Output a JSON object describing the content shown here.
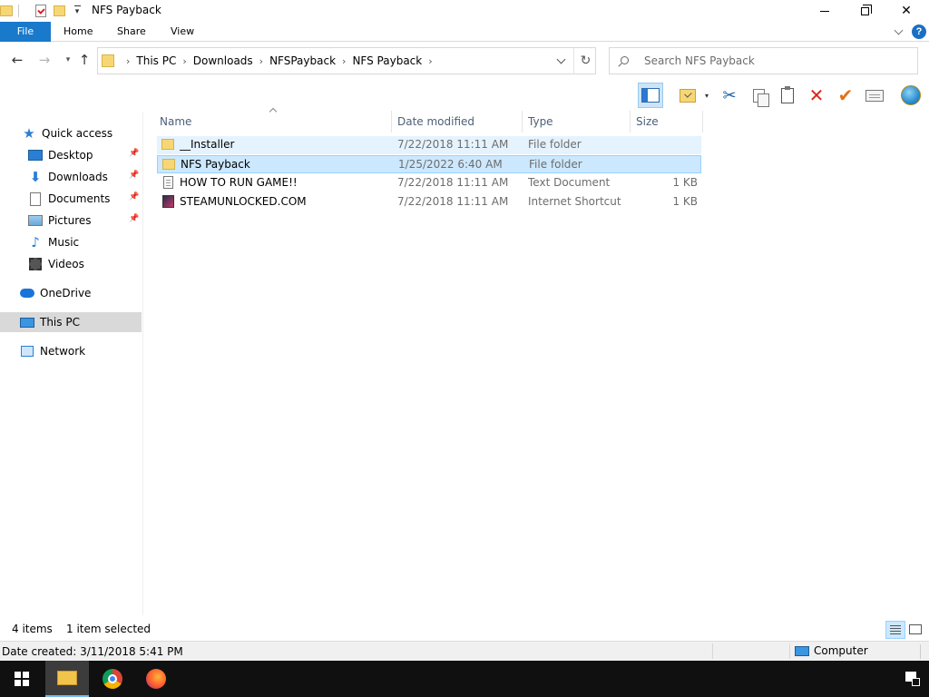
{
  "window": {
    "title": "NFS Payback",
    "controls": {
      "minimize": "minimize",
      "maximize": "restore",
      "close": "✕"
    }
  },
  "ribbon": {
    "tabs": [
      "File",
      "Home",
      "Share",
      "View"
    ],
    "help": "?"
  },
  "address": {
    "crumbs": [
      "This PC",
      "Downloads",
      "NFSPayback",
      "NFS Payback"
    ],
    "search_placeholder": "Search NFS Payback"
  },
  "toolbar": {
    "icons": [
      "preview-pane-icon",
      "view-options-icon",
      "cut-icon",
      "copy-icon",
      "paste-icon",
      "delete-icon",
      "rename-icon",
      "properties-icon",
      "globe-icon"
    ],
    "delete_glyph": "✕",
    "rename_glyph": "✔",
    "cut_glyph": "✂"
  },
  "sidebar": {
    "items": [
      {
        "label": "Quick access",
        "icon": "star-icon"
      },
      {
        "label": "Desktop",
        "icon": "desktop-icon",
        "pinned": true
      },
      {
        "label": "Downloads",
        "icon": "downloads-icon",
        "pinned": true
      },
      {
        "label": "Documents",
        "icon": "documents-icon",
        "pinned": true
      },
      {
        "label": "Pictures",
        "icon": "pictures-icon",
        "pinned": true
      },
      {
        "label": "Music",
        "icon": "music-icon"
      },
      {
        "label": "Videos",
        "icon": "videos-icon"
      },
      {
        "label": "OneDrive",
        "icon": "onedrive-icon"
      },
      {
        "label": "This PC",
        "icon": "this-pc-icon",
        "selected": true
      },
      {
        "label": "Network",
        "icon": "network-icon"
      }
    ]
  },
  "filelist": {
    "columns": [
      "Name",
      "Date modified",
      "Type",
      "Size"
    ],
    "rows": [
      {
        "name": "__Installer",
        "date": "7/22/2018 11:11 AM",
        "type": "File folder",
        "size": "",
        "icon": "folder-icon"
      },
      {
        "name": "NFS Payback",
        "date": "1/25/2022 6:40 AM",
        "type": "File folder",
        "size": "",
        "icon": "folder-icon",
        "selected": true
      },
      {
        "name": "HOW TO RUN GAME!!",
        "date": "7/22/2018 11:11 AM",
        "type": "Text Document",
        "size": "1 KB",
        "icon": "text-document-icon"
      },
      {
        "name": "STEAMUNLOCKED.COM",
        "date": "7/22/2018 11:11 AM",
        "type": "Internet Shortcut",
        "size": "1 KB",
        "icon": "internet-shortcut-icon"
      }
    ]
  },
  "status": {
    "item_count": "4 items",
    "selection": "1 item selected"
  },
  "details": {
    "date_created": "Date created: 3/11/2018 5:41 PM",
    "location": "Computer"
  },
  "taskbar": {
    "apps": [
      "File Explorer",
      "Google Chrome",
      "Firefox"
    ]
  },
  "colors": {
    "file_tab": "#1979ca",
    "selection_bg": "#cce8ff",
    "selection_border": "#99d1ff",
    "taskbar": "#101010"
  }
}
